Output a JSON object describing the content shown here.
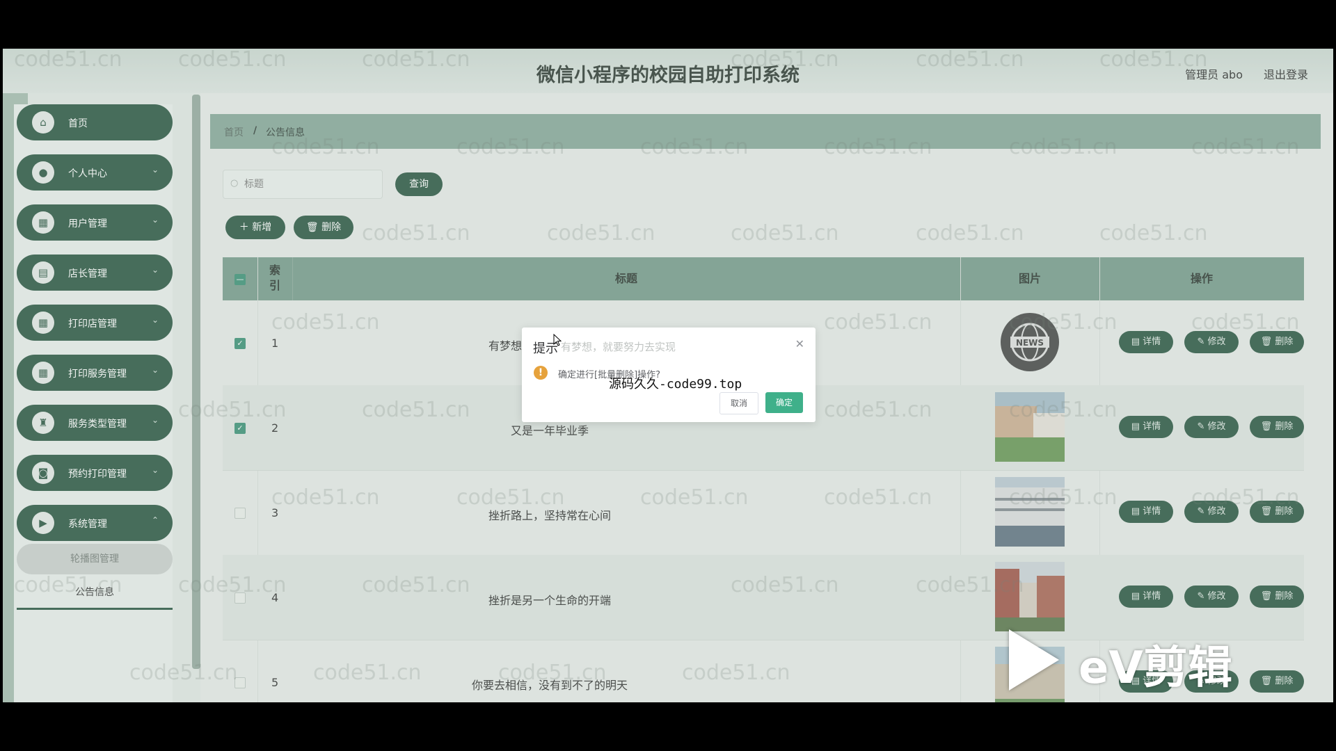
{
  "header": {
    "title": "微信小程序的校园自助打印系统",
    "admin": "管理员 abo",
    "logout": "退出登录"
  },
  "sidebar": {
    "items": [
      {
        "label": "首页",
        "icon": "home-icon"
      },
      {
        "label": "个人中心",
        "icon": "user-icon"
      },
      {
        "label": "用户管理",
        "icon": "grid-icon"
      },
      {
        "label": "店长管理",
        "icon": "briefcase-icon"
      },
      {
        "label": "打印店管理",
        "icon": "grid-icon"
      },
      {
        "label": "打印服务管理",
        "icon": "grid-icon"
      },
      {
        "label": "服务类型管理",
        "icon": "trophy-icon"
      },
      {
        "label": "预约打印管理",
        "icon": "suitcase-icon"
      },
      {
        "label": "系统管理",
        "icon": "video-icon"
      }
    ],
    "sub_items": [
      "轮播图管理",
      "公告信息"
    ]
  },
  "breadcrumb": {
    "home": "首页",
    "separator": "/",
    "current": "公告信息"
  },
  "search": {
    "placeholder": "标题",
    "button": "查询"
  },
  "toolbar": {
    "add": "新增",
    "delete": "删除"
  },
  "table": {
    "headers": {
      "index": "索引",
      "title": "标题",
      "image": "图片",
      "actions": "操作"
    },
    "rows": [
      {
        "index": "1",
        "title": "有梦想，就要努力去实现",
        "checked": true
      },
      {
        "index": "2",
        "title": "又是一年毕业季",
        "checked": true
      },
      {
        "index": "3",
        "title": "挫折路上，坚持常在心间",
        "checked": false
      },
      {
        "index": "4",
        "title": "挫折是另一个生命的开端",
        "checked": false
      },
      {
        "index": "5",
        "title": "你要去相信，没有到不了的明天",
        "checked": false
      }
    ],
    "actions": {
      "detail": "详情",
      "edit": "修改",
      "remove": "删除"
    }
  },
  "dialog": {
    "title": "提示",
    "motto": "有梦想，就要努力去实现",
    "message": "确定进行[批量删除]操作?",
    "cancel": "取消",
    "confirm": "确定",
    "overlay_text": "源码久久-code99.top"
  },
  "watermark": "code51.cn",
  "video_brand": "eV剪辑",
  "news_badge": "NEWS",
  "colors": {
    "primary": "#1d4b36",
    "header_table": "#6e9484",
    "confirm": "#3fb08a",
    "warning": "#e6a23c"
  }
}
